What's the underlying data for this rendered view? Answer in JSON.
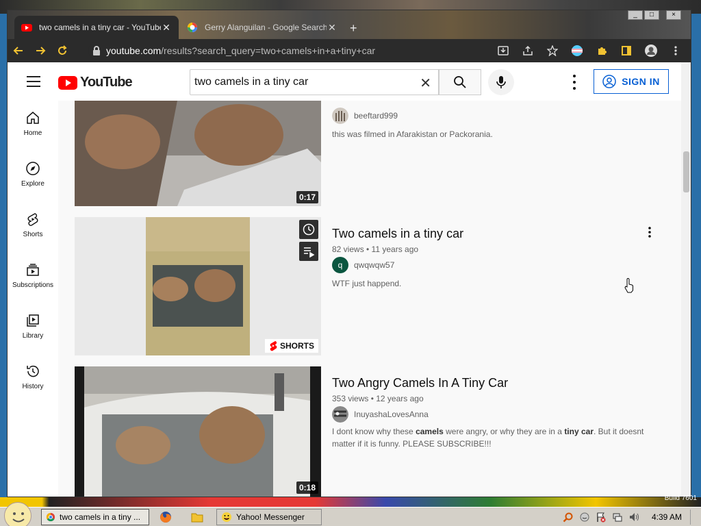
{
  "browser": {
    "tabs": [
      {
        "title": "two camels in a tiny car - YouTube",
        "active": true
      },
      {
        "title": "Gerry Alanguilan - Google Search",
        "active": false
      }
    ],
    "new_tab": "+",
    "url_host": "youtube.com",
    "url_path": "/results?search_query=two+camels+in+a+tiny+car",
    "window_controls": [
      "_",
      "□",
      "×"
    ]
  },
  "youtube": {
    "logo_text": "YouTube",
    "search_value": "two camels in a tiny car",
    "signin_label": "SIGN IN",
    "guide": [
      {
        "label": "Home",
        "icon": "home-icon"
      },
      {
        "label": "Explore",
        "icon": "compass-icon"
      },
      {
        "label": "Shorts",
        "icon": "shorts-icon"
      },
      {
        "label": "Subscriptions",
        "icon": "subscriptions-icon"
      },
      {
        "label": "Library",
        "icon": "library-icon"
      },
      {
        "label": "History",
        "icon": "history-icon"
      }
    ],
    "results": [
      {
        "channel": "beeftard999",
        "description": "this was filmed in Afarakistan or Packorania.",
        "duration": "0:17"
      },
      {
        "title": "Two camels in a tiny car",
        "meta": "82 views • 11 years ago",
        "channel": "qwqwqw57",
        "channel_initial": "q",
        "description": "WTF just happend.",
        "badge": "SHORTS"
      },
      {
        "title": "Two Angry Camels In A Tiny Car",
        "meta": "353 views • 12 years ago",
        "channel": "InuyashaLovesAnna",
        "desc_parts": [
          "I dont know why these ",
          "camels",
          " were angry, or why they are in a ",
          "tiny car",
          ". But it doesnt matter if it is funny. PLEASE SUBSCRIBE!!!"
        ],
        "duration": "0:18"
      }
    ]
  },
  "taskbar": {
    "tasks": [
      {
        "label": "two camels in a tiny ...",
        "pressed": true
      },
      {
        "label": "Yahoo! Messenger",
        "pressed": false
      }
    ],
    "clock": "4:39 AM",
    "build": "Build 7601"
  },
  "colors": {
    "youtube_red": "#ff0000",
    "link_blue": "#065fd4",
    "chrome_dark": "#2b2b2b",
    "toolbar_yellow": "#f1c232"
  }
}
